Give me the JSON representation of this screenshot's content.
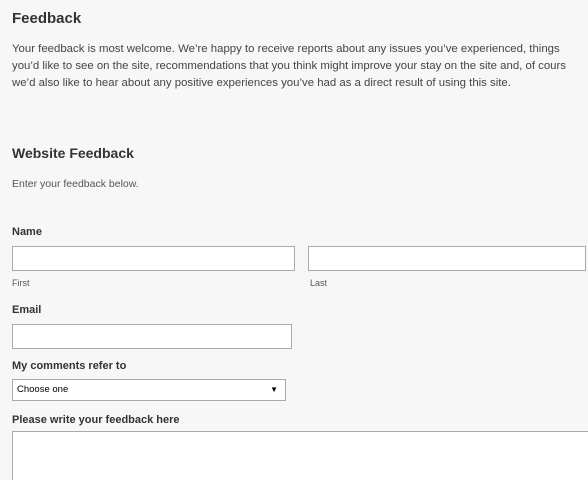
{
  "page": {
    "title": "Feedback",
    "intro_lines": [
      "Your feedback is most welcome. We’re happy to receive reports about any issues you’ve experienced, things",
      "you’d like to see on the site, recommendations that you think might improve your stay on the site and, of cours",
      "we’d also like to hear about any positive experiences you’ve had as a direct result of using this site."
    ]
  },
  "form": {
    "title": "Website Feedback",
    "description": "Enter your feedback below.",
    "name": {
      "label": "Name",
      "first_value": "",
      "first_label": "First",
      "last_value": "",
      "last_label": "Last"
    },
    "email": {
      "label": "Email",
      "value": ""
    },
    "comments_refer": {
      "label": "My comments refer to",
      "selected": "Choose one",
      "arrow_icon": "dropdown-arrow-icon"
    },
    "feedback": {
      "label": "Please write your feedback here",
      "value": ""
    }
  }
}
